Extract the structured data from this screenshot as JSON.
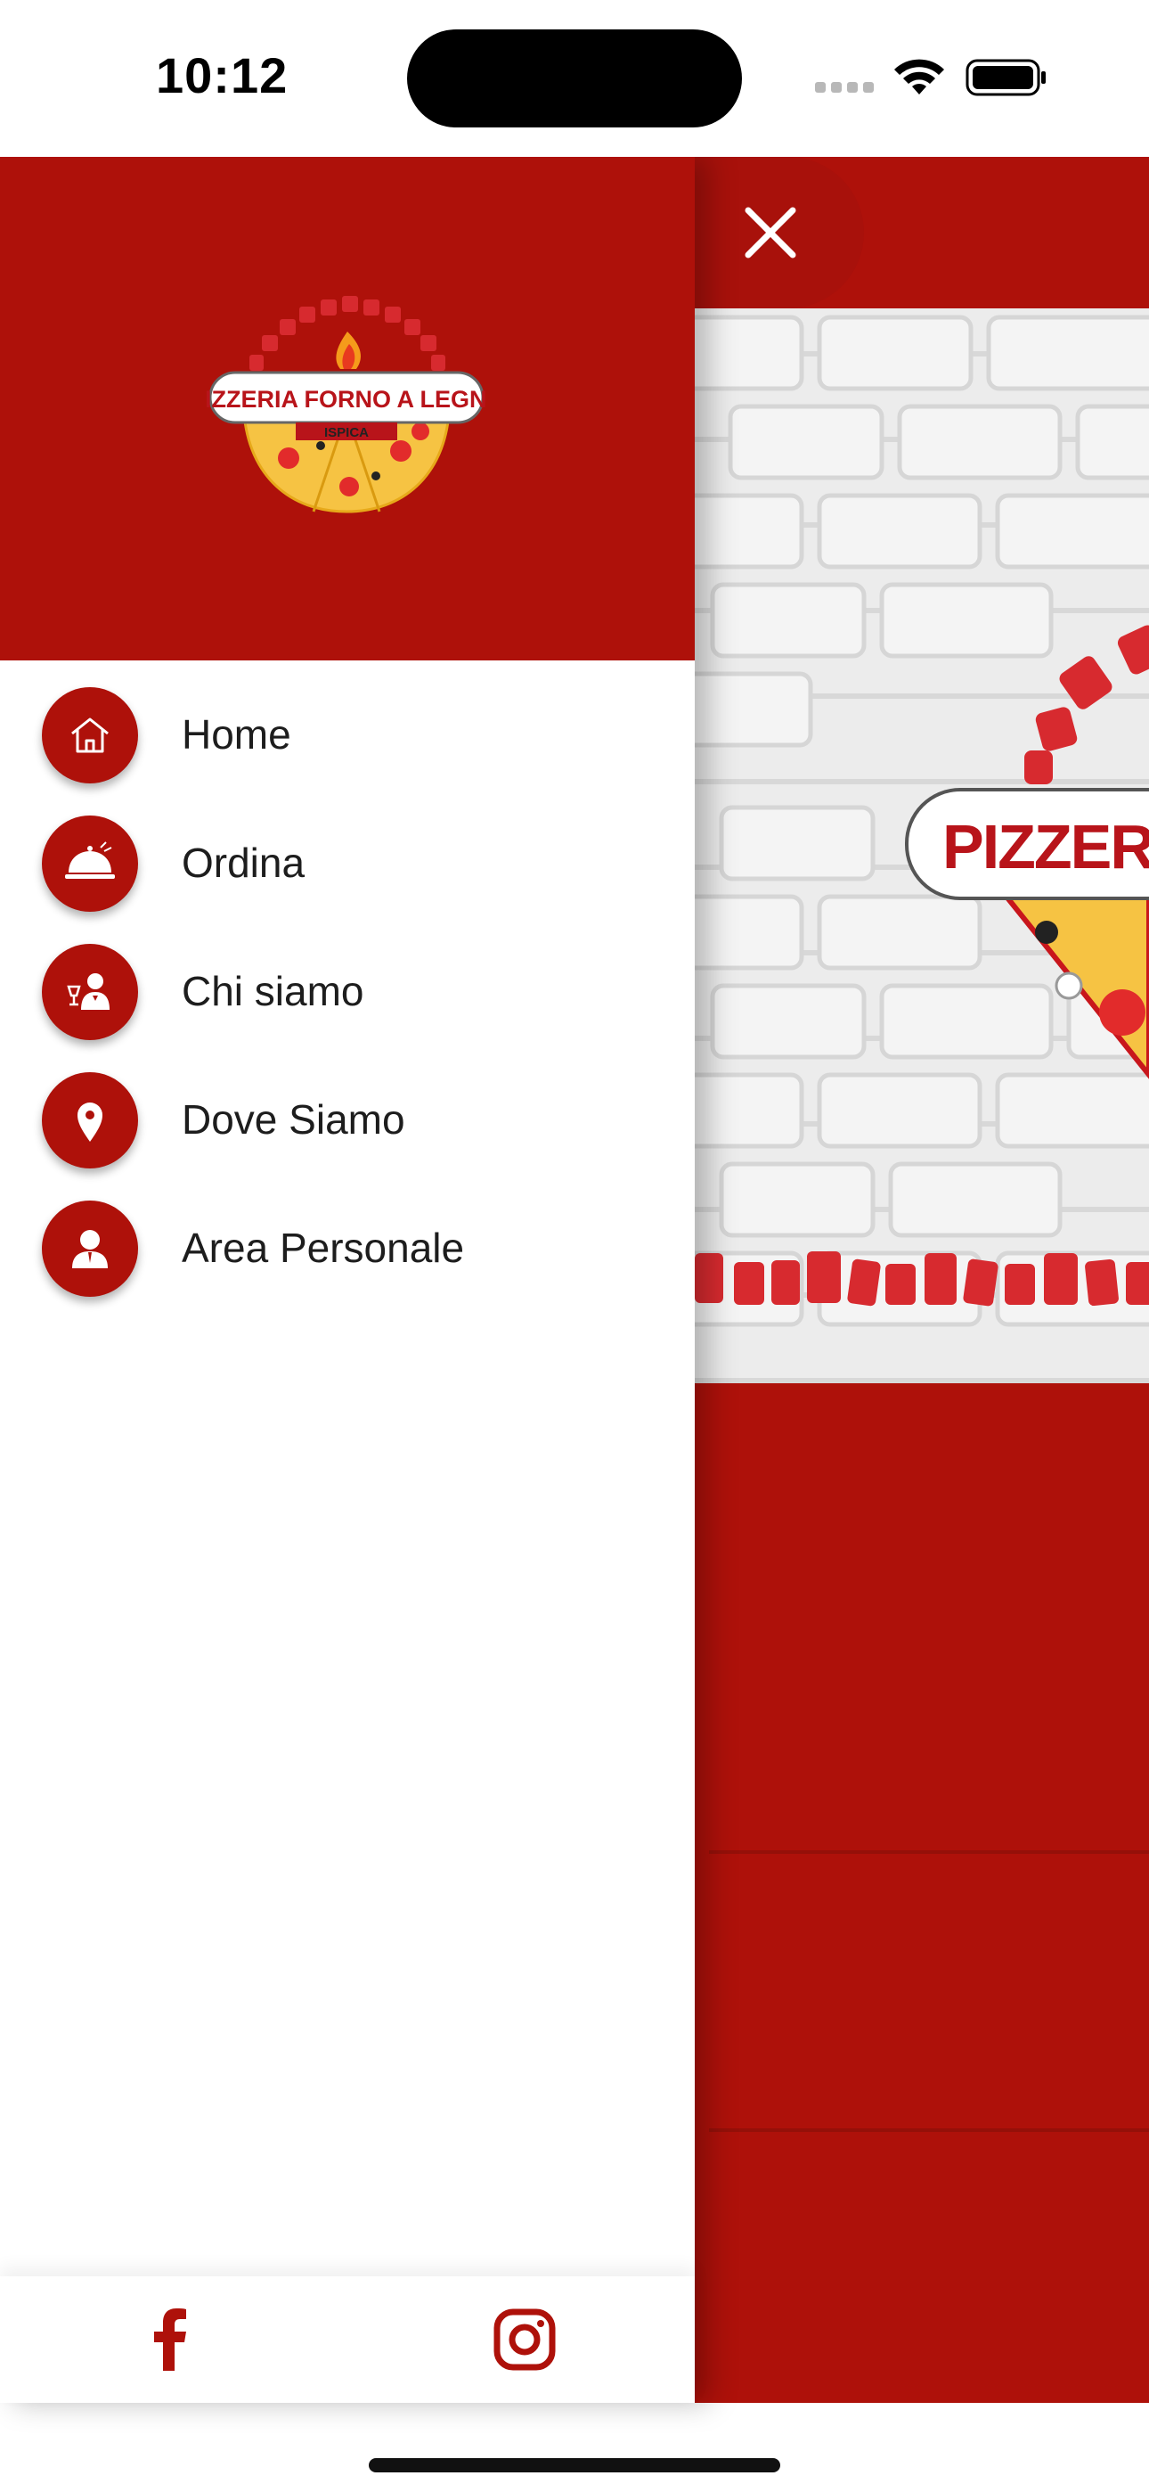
{
  "status_bar": {
    "time": "10:12"
  },
  "drawer": {
    "logo": {
      "name": "pizzeria-forno-a-legna-logo",
      "text_main": "PIZZERIA FORNO A LEGNA",
      "text_sub": "ISPICA"
    },
    "menu": [
      {
        "label": "Home",
        "icon": "home-icon"
      },
      {
        "label": "Ordina",
        "icon": "cloche-icon"
      },
      {
        "label": "Chi siamo",
        "icon": "waiter-icon"
      },
      {
        "label": "Dove Siamo",
        "icon": "location-pin-icon"
      },
      {
        "label": "Area Personale",
        "icon": "user-icon"
      }
    ],
    "footer": {
      "social": [
        {
          "name": "facebook",
          "icon": "facebook-icon"
        },
        {
          "name": "instagram",
          "icon": "instagram-icon"
        }
      ]
    }
  },
  "main": {
    "hero_logo_partial_text": "PIZZERIA",
    "close_icon": "close-icon"
  },
  "colors": {
    "brand_red": "#ae110a",
    "text": "#1d1d1d",
    "background": "#ffffff"
  }
}
